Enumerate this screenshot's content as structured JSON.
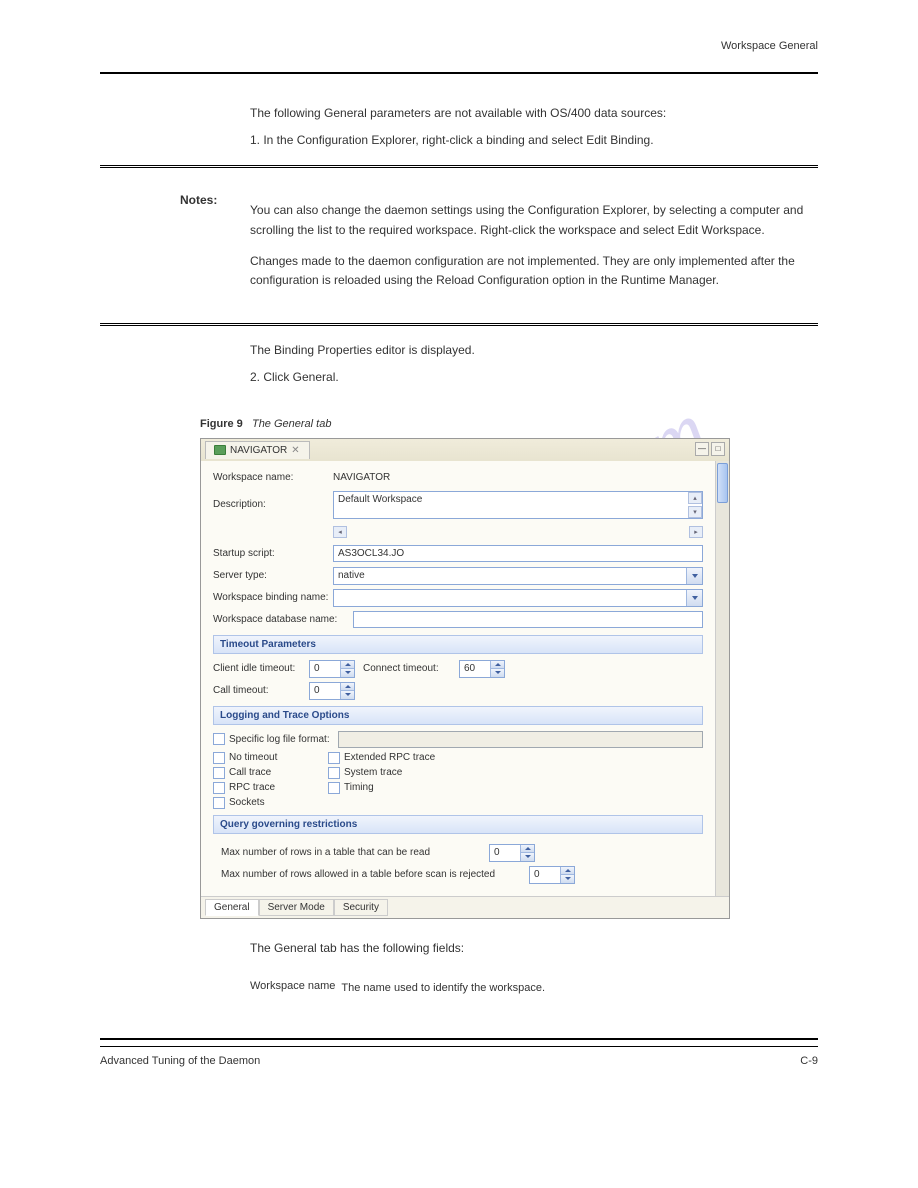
{
  "header_text": "Workspace General",
  "intro_1": "The following General parameters are not available with OS/400 data sources:",
  "intro_2": "1.  In the Configuration Explorer, right-click a binding and select Edit Binding.",
  "note_label": "Notes:",
  "note_body_1": "You can also change the daemon settings using the Configuration Explorer, by selecting a computer and scrolling the list to the required workspace. Right-click the workspace and select Edit Workspace.",
  "note_body_2": "Changes made to the daemon configuration are not implemented. They are only implemented after the configuration is reloaded using the Reload Configuration option in the Runtime Manager.",
  "body_after": "The Binding Properties editor is displayed.",
  "body_click": "2.  Click General.",
  "fig_label": "Figure 9",
  "fig_caption": "The General tab",
  "tab": {
    "title": "NAVIGATOR"
  },
  "form": {
    "ws_name_label": "Workspace name:",
    "ws_name_value": "NAVIGATOR",
    "desc_label": "Description:",
    "desc_value": "Default Workspace",
    "startup_label": "Startup script:",
    "startup_value": "AS3OCL34.JO",
    "server_type_label": "Server type:",
    "server_type_value": "native",
    "ws_binding_label": "Workspace binding name:",
    "ws_db_label": "Workspace database name:"
  },
  "sections": {
    "timeout": "Timeout Parameters",
    "logging": "Logging and Trace Options",
    "query": "Query governing restrictions"
  },
  "timeout": {
    "client_idle_label": "Client idle timeout:",
    "client_idle_value": "0",
    "connect_label": "Connect timeout:",
    "connect_value": "60",
    "call_label": "Call timeout:",
    "call_value": "0"
  },
  "logging": {
    "specific": "Specific log file format:",
    "no_timeout": "No timeout",
    "call_trace": "Call trace",
    "rpc_trace": "RPC trace",
    "sockets": "Sockets",
    "ext_rpc": "Extended RPC trace",
    "sys_trace": "System trace",
    "timing": "Timing"
  },
  "query": {
    "max_read": "Max number of rows in a table that can be read",
    "max_read_val": "0",
    "max_scan": "Max number of rows allowed in a table before scan is rejected",
    "max_scan_val": "0"
  },
  "bottom_tabs": {
    "general": "General",
    "server": "Server Mode",
    "security": "Security"
  },
  "fields_intro": "The General tab has the following fields:",
  "field1_label": "Workspace name",
  "field1_desc": "The name used to identify the workspace.",
  "footer_left": "Advanced Tuning of the Daemon",
  "footer_right": "C-9",
  "watermark": "manualshive.com"
}
